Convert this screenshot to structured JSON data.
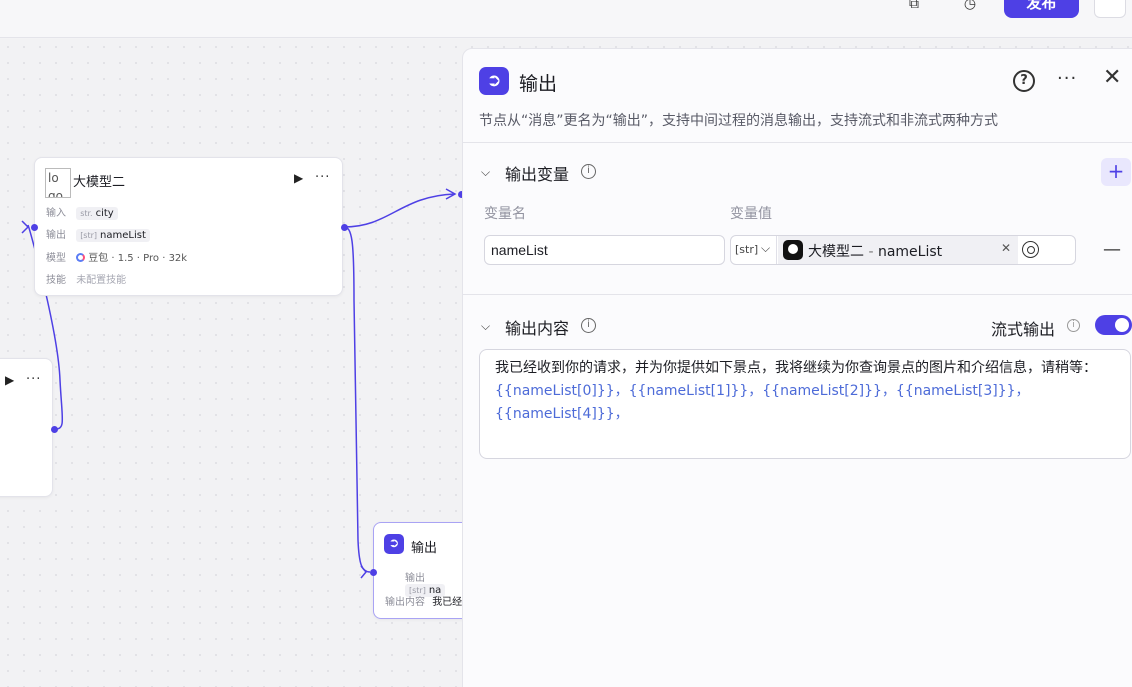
{
  "topbar": {
    "publish_label": "发布"
  },
  "colors": {
    "accent": "#4e40e5",
    "edge": "#4e40e5"
  },
  "llm_node": {
    "img_alt": "lo go",
    "title": "大模型二",
    "rows": [
      {
        "label": "输入",
        "type": "str.",
        "value": "city"
      },
      {
        "label": "输出",
        "type": "[str]",
        "value": "nameList"
      },
      {
        "label": "模型",
        "value": "豆包 · 1.5 · Pro · 32k"
      },
      {
        "label": "技能",
        "value": "未配置技能"
      }
    ]
  },
  "output_node": {
    "title": "输出",
    "rows": [
      {
        "label": "输出",
        "type": "[str]",
        "value": "na"
      },
      {
        "label": "输出内容",
        "value": "我已经"
      }
    ]
  },
  "panel": {
    "title": "输出",
    "help": "?",
    "description": "节点从“消息”更名为“输出”，支持中间过程的消息输出，支持流式和非流式两种方式",
    "variables": {
      "section_title": "输出变量",
      "col_name": "变量名",
      "col_value": "变量值",
      "row": {
        "name": "nameList",
        "type": "[str]",
        "ref_node": "大模型二",
        "ref_sep": " - ",
        "ref_var": "nameList"
      }
    },
    "content": {
      "section_title": "输出内容",
      "stream_label": "流式输出",
      "stream_on": true,
      "text": "我已经收到你的请求，并为你提供如下景点，我将继续为你查询景点的图片和介绍信息，请稍等：",
      "vars_text": "{{nameList[0]}}，{{nameList[1]}}，{{nameList[2]}}，{{nameList[3]}}，{{nameList[4]}}，"
    }
  }
}
